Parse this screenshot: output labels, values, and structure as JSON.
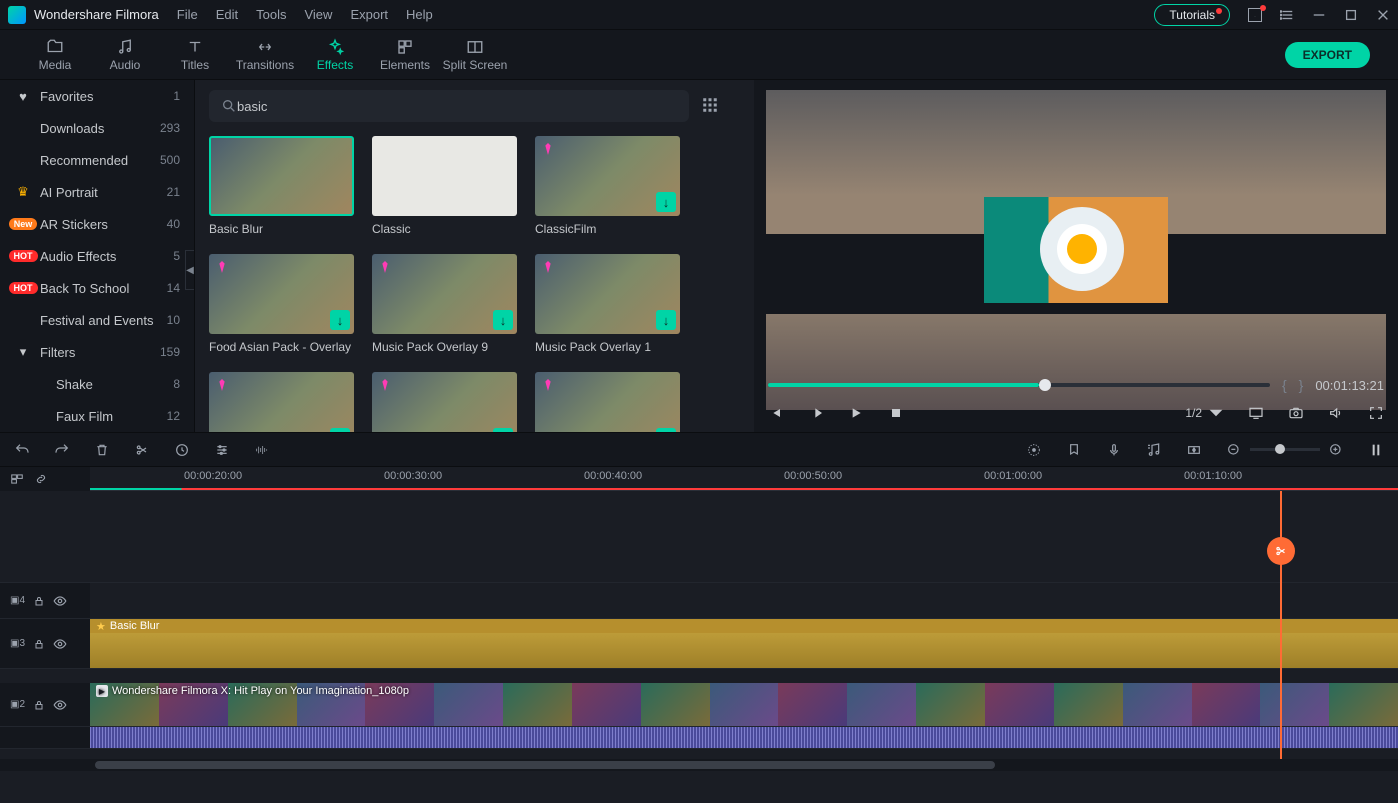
{
  "app": {
    "title": "Wondershare Filmora"
  },
  "menu": [
    "File",
    "Edit",
    "Tools",
    "View",
    "Export",
    "Help"
  ],
  "titlebar": {
    "tutorials": "Tutorials"
  },
  "tabs": [
    {
      "id": "media",
      "label": "Media"
    },
    {
      "id": "audio",
      "label": "Audio"
    },
    {
      "id": "titles",
      "label": "Titles"
    },
    {
      "id": "transitions",
      "label": "Transitions"
    },
    {
      "id": "effects",
      "label": "Effects",
      "active": true
    },
    {
      "id": "elements",
      "label": "Elements"
    },
    {
      "id": "splitscreen",
      "label": "Split Screen"
    }
  ],
  "export_label": "EXPORT",
  "sidebar": [
    {
      "icon": "heart",
      "label": "Favorites",
      "count": 1
    },
    {
      "label": "Downloads",
      "count": 293,
      "sub": true
    },
    {
      "label": "Recommended",
      "count": 500,
      "sub": true
    },
    {
      "icon": "crown",
      "label": "AI Portrait",
      "count": 21
    },
    {
      "badge": "New",
      "label": "AR Stickers",
      "count": 40
    },
    {
      "badge": "HOT",
      "label": "Audio Effects",
      "count": 5
    },
    {
      "badge": "HOT",
      "label": "Back To School",
      "count": 14
    },
    {
      "label": "Festival and Events",
      "count": 10,
      "sub": true
    },
    {
      "icon": "caret",
      "label": "Filters",
      "count": 159
    },
    {
      "label": "Shake",
      "count": 8,
      "sub": true,
      "deep": true
    },
    {
      "label": "Faux Film",
      "count": 12,
      "sub": true,
      "deep": true
    }
  ],
  "search": {
    "placeholder": "",
    "value": "basic"
  },
  "thumbs": [
    {
      "label": "Basic Blur",
      "selected": true
    },
    {
      "label": "Classic",
      "classic": true
    },
    {
      "label": "ClassicFilm",
      "gem": true,
      "dl": true
    },
    {
      "label": "Food Asian Pack - Overlay",
      "gem": true,
      "dl": true
    },
    {
      "label": "Music Pack Overlay 9",
      "gem": true,
      "dl": true
    },
    {
      "label": "Music Pack Overlay 1",
      "gem": true,
      "dl": true
    },
    {
      "label": "",
      "gem": true,
      "dl": true,
      "partial": true
    },
    {
      "label": "",
      "gem": true,
      "dl": true,
      "partial": true
    },
    {
      "label": "",
      "gem": true,
      "dl": true,
      "partial": true
    }
  ],
  "preview": {
    "timecode": "00:01:13:21",
    "zoom": "1/2",
    "progress_pct": 54
  },
  "ruler": [
    "00:00:20:00",
    "00:00:30:00",
    "00:00:40:00",
    "00:00:50:00",
    "00:01:00:00",
    "00:01:10:00"
  ],
  "tracks": {
    "t4": "4",
    "t3": "3",
    "t2": "2",
    "effect_clip": "Basic Blur",
    "video_title": "Wondershare Filmora X: Hit Play on Your Imagination_1080p"
  },
  "playhead_left_pct": 91
}
